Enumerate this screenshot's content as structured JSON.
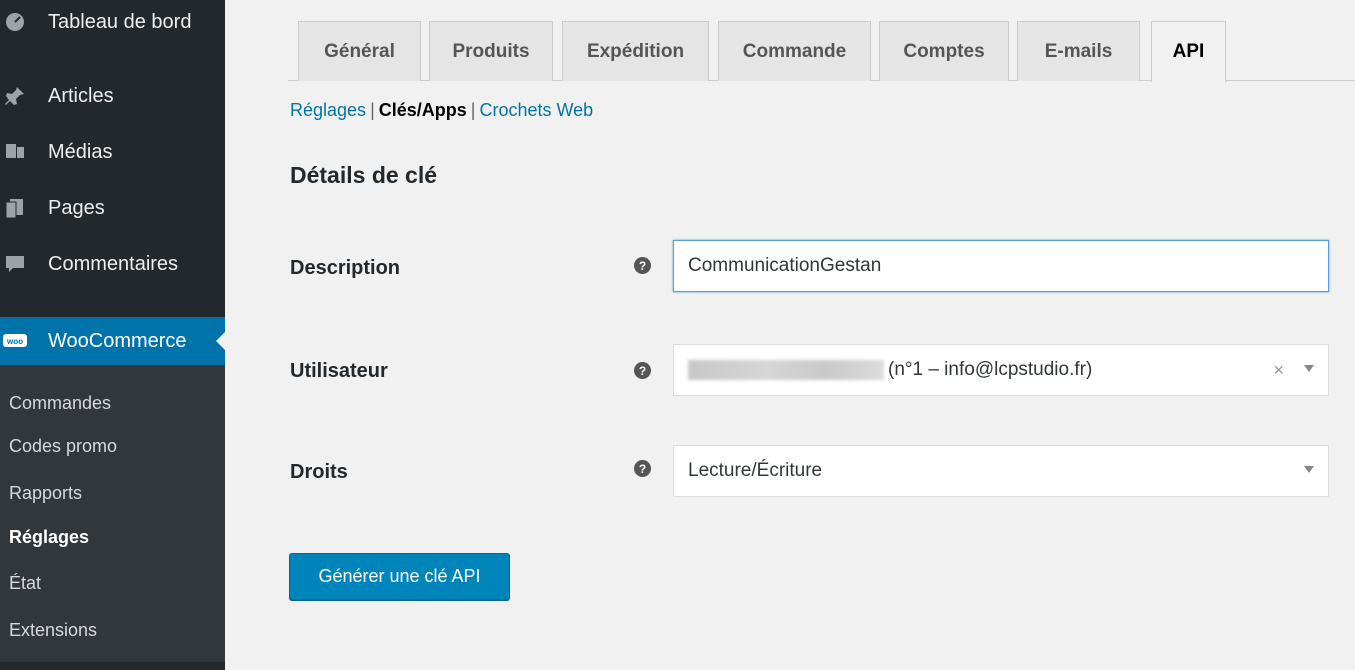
{
  "sidebar": {
    "items": [
      {
        "label": "Tableau de bord",
        "icon": "dashboard-icon"
      },
      {
        "label": "Articles",
        "icon": "pushpin-icon"
      },
      {
        "label": "Médias",
        "icon": "media-icon"
      },
      {
        "label": "Pages",
        "icon": "pages-icon"
      },
      {
        "label": "Commentaires",
        "icon": "comment-icon"
      },
      {
        "label": "WooCommerce",
        "icon": "woocommerce-icon",
        "badge": "woo"
      }
    ],
    "submenu": [
      {
        "label": "Commandes"
      },
      {
        "label": "Codes promo"
      },
      {
        "label": "Rapports"
      },
      {
        "label": "Réglages"
      },
      {
        "label": "État"
      },
      {
        "label": "Extensions"
      }
    ]
  },
  "tabs": [
    {
      "label": "Général"
    },
    {
      "label": "Produits"
    },
    {
      "label": "Expédition"
    },
    {
      "label": "Commande"
    },
    {
      "label": "Comptes"
    },
    {
      "label": "E-mails"
    },
    {
      "label": "API"
    }
  ],
  "subnav": {
    "settings": "Réglages",
    "keys": "Clés/Apps",
    "webhooks": "Crochets Web",
    "separator": "|"
  },
  "section_title": "Détails de clé",
  "form": {
    "description_label": "Description",
    "description_value": "CommunicationGestan",
    "user_label": "Utilisateur",
    "user_value": "(n°1 – info@lcpstudio.fr)",
    "clear_symbol": "×",
    "permissions_label": "Droits",
    "permissions_value": "Lecture/Écriture",
    "help_symbol": "?"
  },
  "generate_button": "Générer une clé API",
  "colors": {
    "sidebar_bg": "#23282d",
    "submenu_bg": "#32373c",
    "accent": "#0073aa",
    "button": "#0085ba"
  }
}
